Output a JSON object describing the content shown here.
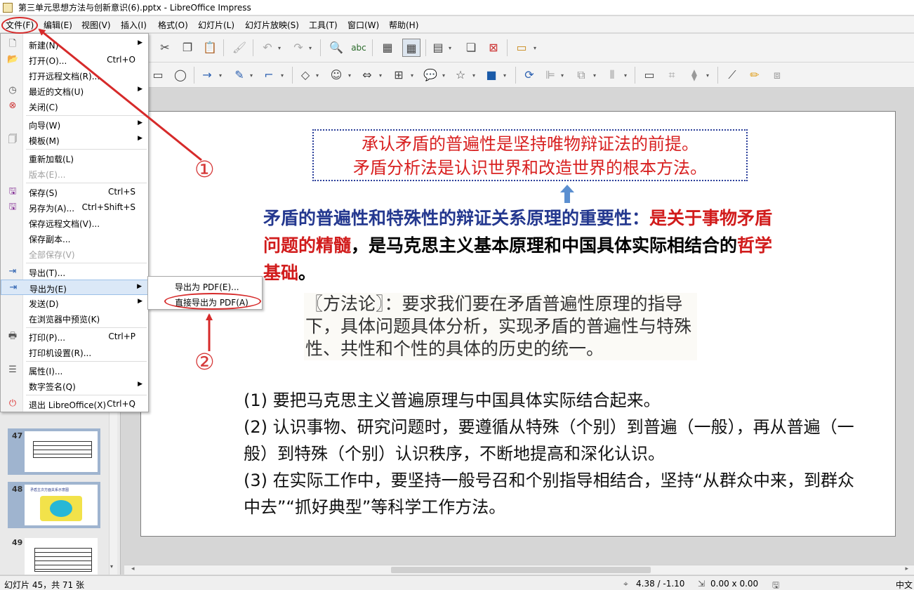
{
  "window": {
    "title": "第三单元思想方法与创新意识(6).pptx - LibreOffice Impress"
  },
  "menubar": [
    "文件(F)",
    "编辑(E)",
    "视图(V)",
    "插入(I)",
    "格式(O)",
    "幻灯片(L)",
    "幻灯片放映(S)",
    "工具(T)",
    "窗口(W)",
    "帮助(H)"
  ],
  "file_menu": [
    {
      "label": "新建(N)",
      "shortcut": "",
      "submenu": true,
      "enabled": true,
      "icon": "new-document-icon"
    },
    {
      "label": "打开(O)...",
      "shortcut": "Ctrl+O",
      "submenu": false,
      "enabled": true,
      "icon": "open-folder-icon"
    },
    {
      "label": "打开远程文档(R)...",
      "shortcut": "",
      "submenu": false,
      "enabled": true,
      "icon": ""
    },
    {
      "label": "最近的文档(U)",
      "shortcut": "",
      "submenu": true,
      "enabled": true,
      "icon": "clock-icon"
    },
    {
      "label": "关闭(C)",
      "shortcut": "",
      "submenu": false,
      "enabled": true,
      "icon": "close-document-icon"
    },
    {
      "label": "向导(W)",
      "shortcut": "",
      "submenu": true,
      "enabled": true,
      "icon": ""
    },
    {
      "label": "模板(M)",
      "shortcut": "",
      "submenu": true,
      "enabled": true,
      "icon": "template-icon"
    },
    {
      "label": "重新加载(L)",
      "shortcut": "",
      "submenu": false,
      "enabled": true,
      "icon": ""
    },
    {
      "label": "版本(E)...",
      "shortcut": "",
      "submenu": false,
      "enabled": false,
      "icon": ""
    },
    {
      "label": "保存(S)",
      "shortcut": "Ctrl+S",
      "submenu": false,
      "enabled": true,
      "icon": "save-icon"
    },
    {
      "label": "另存为(A)...",
      "shortcut": "Ctrl+Shift+S",
      "submenu": false,
      "enabled": true,
      "icon": "save-as-icon"
    },
    {
      "label": "保存远程文档(V)...",
      "shortcut": "",
      "submenu": false,
      "enabled": true,
      "icon": ""
    },
    {
      "label": "保存副本...",
      "shortcut": "",
      "submenu": false,
      "enabled": true,
      "icon": ""
    },
    {
      "label": "全部保存(V)",
      "shortcut": "",
      "submenu": false,
      "enabled": false,
      "icon": ""
    },
    {
      "label": "导出(T)...",
      "shortcut": "",
      "submenu": false,
      "enabled": true,
      "icon": "export-icon"
    },
    {
      "label": "导出为(E)",
      "shortcut": "",
      "submenu": true,
      "enabled": true,
      "icon": "export-as-icon"
    },
    {
      "label": "发送(D)",
      "shortcut": "",
      "submenu": true,
      "enabled": true,
      "icon": ""
    },
    {
      "label": "在浏览器中预览(K)",
      "shortcut": "",
      "submenu": false,
      "enabled": true,
      "icon": ""
    },
    {
      "label": "打印(P)...",
      "shortcut": "Ctrl+P",
      "submenu": false,
      "enabled": true,
      "icon": "printer-icon"
    },
    {
      "label": "打印机设置(R)...",
      "shortcut": "",
      "submenu": false,
      "enabled": true,
      "icon": ""
    },
    {
      "label": "属性(I)...",
      "shortcut": "",
      "submenu": false,
      "enabled": true,
      "icon": "properties-icon"
    },
    {
      "label": "数字签名(Q)",
      "shortcut": "",
      "submenu": true,
      "enabled": true,
      "icon": ""
    },
    {
      "label": "退出 LibreOffice(X)",
      "shortcut": "Ctrl+Q",
      "submenu": false,
      "enabled": true,
      "icon": "exit-icon"
    }
  ],
  "export_submenu": [
    "导出为 PDF(E)...",
    "直接导出为 PDF(A)"
  ],
  "callouts": [
    "①",
    "②"
  ],
  "slide_panel": {
    "thumbnails": [
      {
        "number": "47"
      },
      {
        "number": "48",
        "title": "矛盾主次方面关系示意图"
      },
      {
        "number": "49"
      }
    ]
  },
  "slide": {
    "top_box": [
      "承认矛盾的普遍性是坚持唯物辩证法的前提。",
      "矛盾分析法是认识世界和改造世界的根本方法。"
    ],
    "heading": {
      "part1": "矛盾的普遍性和特殊性的辩证关系原理的重要性：",
      "part2": "是关于事物矛盾问题的精髓",
      "part3": "，是马克思主义基本原理和中国具体实际相结合的",
      "part4": "哲学基础",
      "part5": "。"
    },
    "quote": "〖方法论〗：要求我们要在矛盾普遍性原理的指导下，具体问题具体分析，实现矛盾的普遍性与特殊性、共性和个性的具体的历史的统一。",
    "points": [
      "(1) 要把马克思主义普遍原理与中国具体实际结合起来。",
      "(2) 认识事物、研究问题时，要遵循从特殊（个别）到普遍（一般），再从普遍（一般）到特殊（个别）认识秩序，不断地提高和深化认识。",
      "(3) 在实际工作中，要坚持一般号召和个别指导相结合，坚持“从群众中来，到群众中去”“抓好典型”等科学工作方法。"
    ]
  },
  "status": {
    "slide_info": "幻灯片 45，共 71 张",
    "position": "4.38 / -1.10",
    "size": "0.00 x 0.00",
    "language": "中文"
  },
  "colors": {
    "annotation_red": "#d62a2a",
    "heading_blue": "#24388f",
    "heading_red": "#d11c1c",
    "menu_highlight": "#dbe8f7"
  }
}
